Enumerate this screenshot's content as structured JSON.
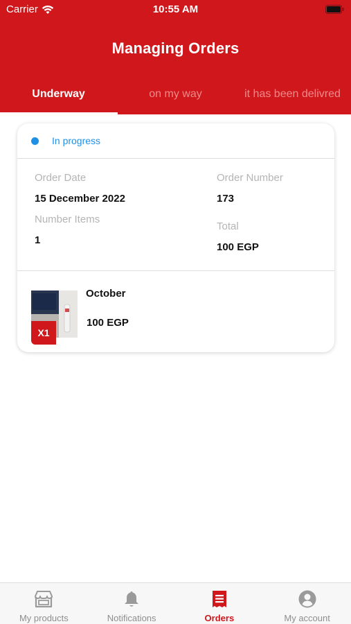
{
  "status_bar": {
    "carrier": "Carrier",
    "time": "10:55 AM"
  },
  "header": {
    "title": "Managing Orders"
  },
  "tabs": [
    {
      "label": "Underway",
      "active": true
    },
    {
      "label": "on my way",
      "active": false
    },
    {
      "label": "it has been delivred",
      "active": false
    }
  ],
  "order": {
    "status": "In progress",
    "status_color": "#1e90e6",
    "order_date_label": "Order Date",
    "order_date": "15 December 2022",
    "order_number_label": "Order Number",
    "order_number": "173",
    "number_items_label": "Number Items",
    "number_items": "1",
    "total_label": "Total",
    "total": "100 EGP",
    "item": {
      "quantity": "X1",
      "name": "October",
      "price": "100 EGP"
    }
  },
  "bottom_nav": [
    {
      "label": "My products",
      "icon": "store-icon",
      "active": false
    },
    {
      "label": "Notifications",
      "icon": "bell-icon",
      "active": false
    },
    {
      "label": "Orders",
      "icon": "receipt-icon",
      "active": true
    },
    {
      "label": "My account",
      "icon": "account-icon",
      "active": false
    }
  ],
  "colors": {
    "brand": "#cf171c",
    "status_blue": "#1e90e6"
  }
}
